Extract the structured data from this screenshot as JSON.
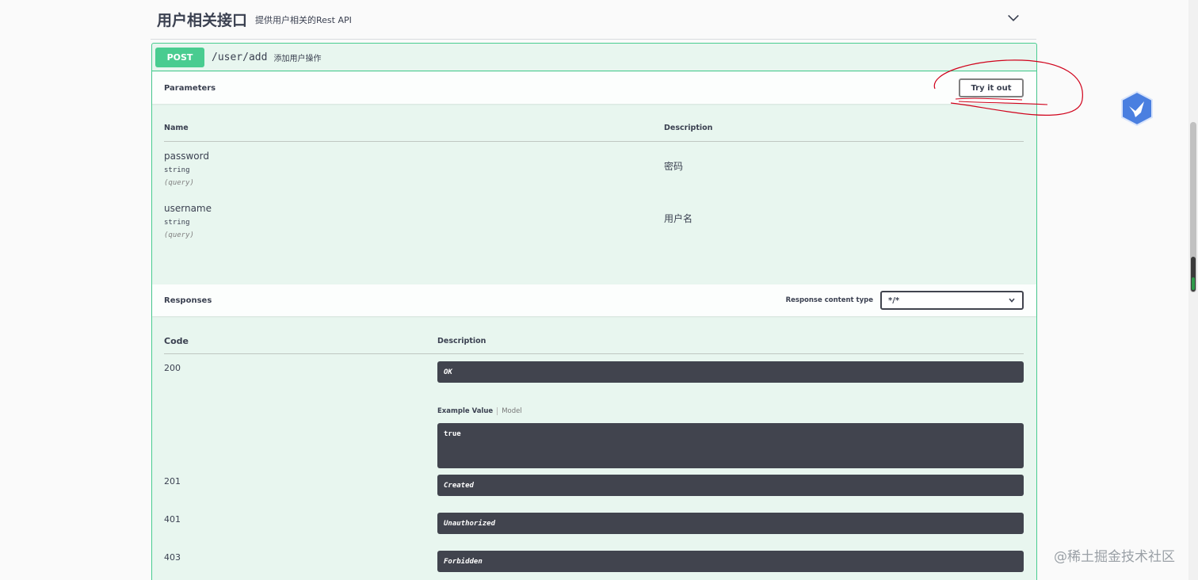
{
  "tag": {
    "title": "用户相关接口",
    "description": "提供用户相关的Rest API"
  },
  "operation": {
    "method": "POST",
    "path": "/user/add",
    "summary": "添加用户操作"
  },
  "parameters": {
    "section_title": "Parameters",
    "try_it_out_label": "Try it out",
    "col_name": "Name",
    "col_description": "Description",
    "items": [
      {
        "name": "password",
        "type": "string",
        "in": "(query)",
        "description": "密码"
      },
      {
        "name": "username",
        "type": "string",
        "in": "(query)",
        "description": "用户名"
      }
    ]
  },
  "responses": {
    "section_title": "Responses",
    "content_type_label": "Response content type",
    "content_type_value": "*/*",
    "col_code": "Code",
    "col_description": "Description",
    "items": [
      {
        "code": "200",
        "description": "OK"
      },
      {
        "code": "201",
        "description": "Created"
      },
      {
        "code": "401",
        "description": "Unauthorized"
      },
      {
        "code": "403",
        "description": "Forbidden"
      }
    ],
    "example_value_tab": "Example Value",
    "model_tab": "Model",
    "example_value": "true"
  },
  "watermark": "@稀土掘金技术社区",
  "colors": {
    "post_green": "#49cc90",
    "opblock_bg": "#e8f6ef",
    "dark_bar": "#41444e",
    "annotation_red": "#d0021b"
  }
}
